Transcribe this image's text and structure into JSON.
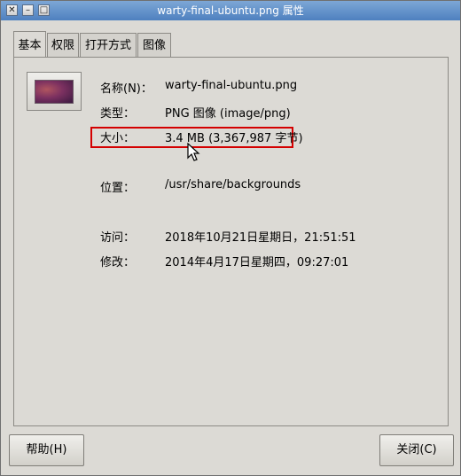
{
  "window": {
    "title": "warty-final-ubuntu.png 属性",
    "controls": {
      "close_glyph": "✕",
      "minimize_glyph": "–",
      "maximize_glyph": "□"
    }
  },
  "tabs": [
    {
      "label": "基本",
      "active": true
    },
    {
      "label": "权限",
      "active": false
    },
    {
      "label": "打开方式",
      "active": false
    },
    {
      "label": "图像",
      "active": false
    }
  ],
  "info": {
    "name_label": "名称(N)：",
    "name_value": "warty-final-ubuntu.png",
    "type_label": "类型：",
    "type_value": "PNG 图像 (image/png)",
    "size_label": "大小：",
    "size_value": "3.4 MB (3,367,987 字节)",
    "location_label": "位置：",
    "location_value": "/usr/share/backgrounds",
    "accessed_label": "访问：",
    "accessed_value": "2018年10月21日星期日，21:51:51",
    "modified_label": "修改：",
    "modified_value": "2014年4月17日星期四，09:27:01"
  },
  "buttons": {
    "help_label": "帮助(H)",
    "close_label": "关闭(C)"
  },
  "colors": {
    "highlight": "#d40000",
    "titlebar": "#5b8ac6",
    "background": "#dcdad5"
  }
}
